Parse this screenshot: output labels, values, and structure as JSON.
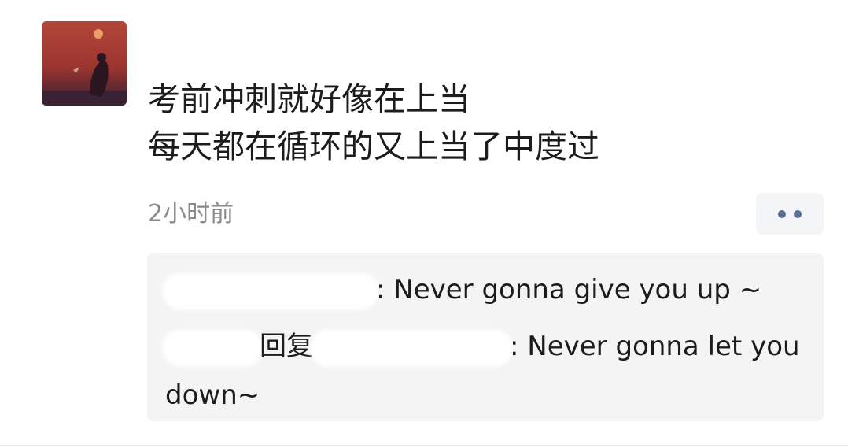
{
  "post": {
    "username": "",
    "lines": [
      "考前冲刺就好像在上当",
      "每天都在循环的又上当了中度过"
    ],
    "timestamp": "2小时前"
  },
  "comments": [
    {
      "name": "",
      "text": ": Never gonna give you up ~"
    },
    {
      "name": "",
      "reply_label": "回复",
      "reply_to": "",
      "text": ": Never gonna let you down~"
    }
  ],
  "colors": {
    "link": "#5a6d94",
    "text": "#1c1c1c",
    "muted": "#8a8a8a",
    "panel": "#f4f4f4"
  },
  "icons": {
    "more": "more-dots-icon"
  }
}
